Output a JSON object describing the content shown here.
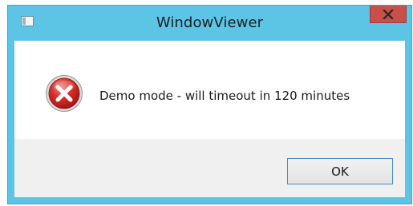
{
  "window": {
    "title": "WindowViewer",
    "app_icon": "app-window-icon",
    "close_icon": "close-icon",
    "title_bar_color": "#5cc5e6",
    "close_button_color": "#c7504a"
  },
  "dialog": {
    "icon": "error-icon",
    "message": "Demo mode - will timeout in 120 minutes",
    "ok_label": "OK"
  }
}
